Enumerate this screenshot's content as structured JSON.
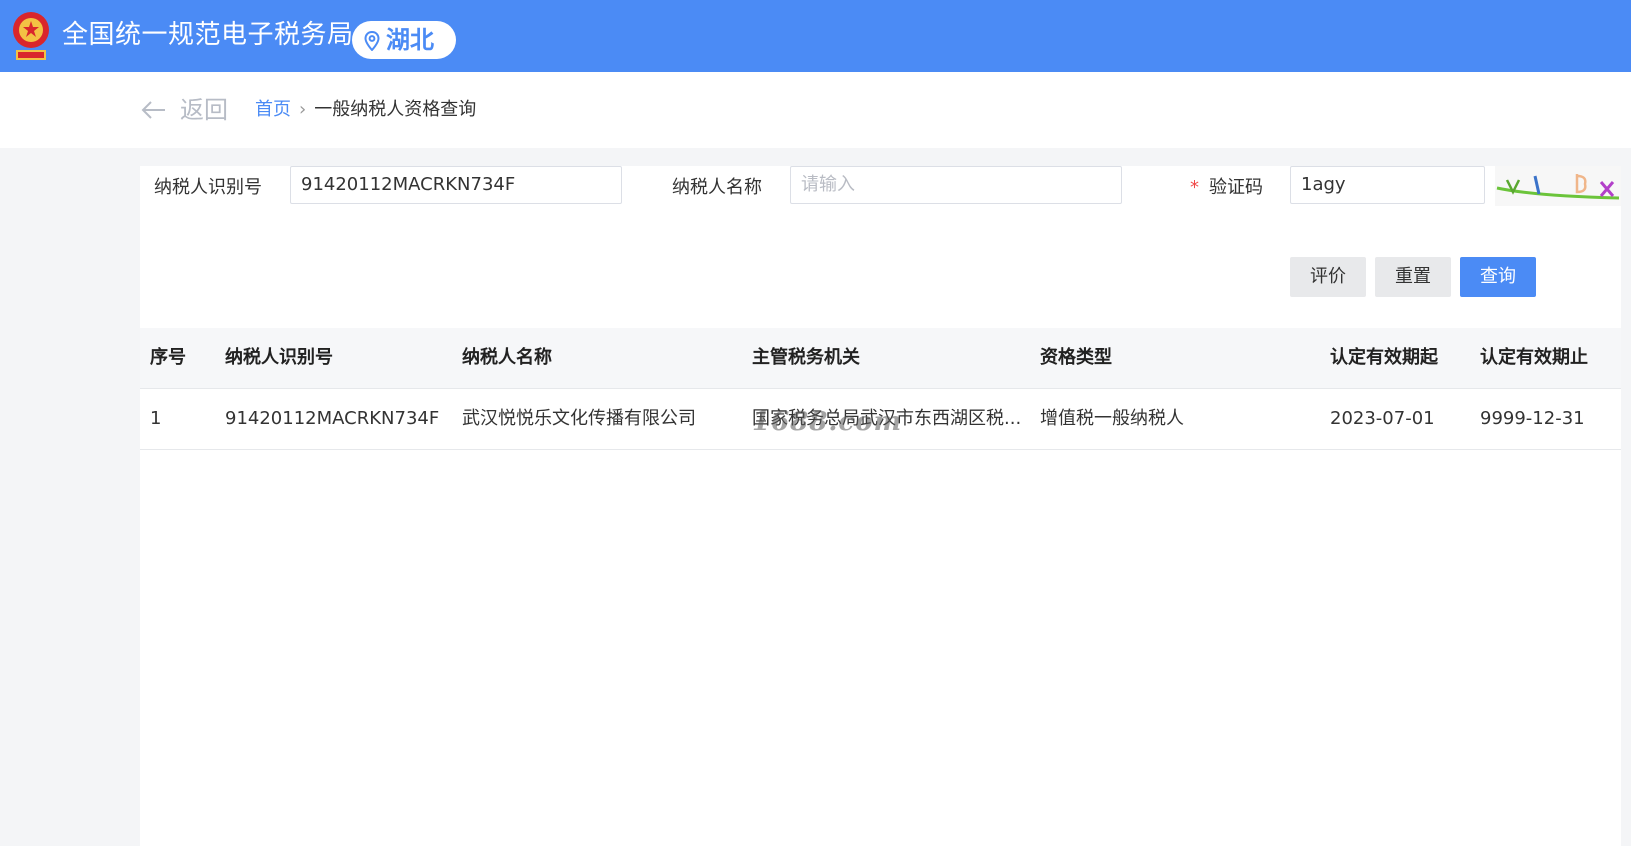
{
  "header": {
    "site_title": "全国统一规范电子税务局",
    "region": "湖北",
    "colors": {
      "brand": "#4b8bf5"
    }
  },
  "nav": {
    "back_label": "返回",
    "breadcrumb": {
      "home": "首页",
      "separator": "›",
      "current": "一般纳税人资格查询"
    }
  },
  "form": {
    "taxpayer_id_label": "纳税人识别号",
    "taxpayer_id_value": "91420112MACRKN734F",
    "taxpayer_name_label": "纳税人名称",
    "taxpayer_name_placeholder": "请输入",
    "captcha_required_mark": "*",
    "captcha_label": "验证码",
    "captcha_value": "1agy"
  },
  "buttons": {
    "evaluate": "评价",
    "reset": "重置",
    "query": "查询"
  },
  "table": {
    "headers": [
      "序号",
      "纳税人识别号",
      "纳税人名称",
      "主管税务机关",
      "资格类型",
      "认定有效期起",
      "认定有效期止"
    ],
    "rows": [
      [
        "1",
        "91420112MACRKN734F",
        "武汉悦悦乐文化传播有限公司",
        "国家税务总局武汉市东西湖区税...",
        "增值税一般纳税人",
        "2023-07-01",
        "9999-12-31"
      ]
    ]
  },
  "watermark": "1688.com"
}
